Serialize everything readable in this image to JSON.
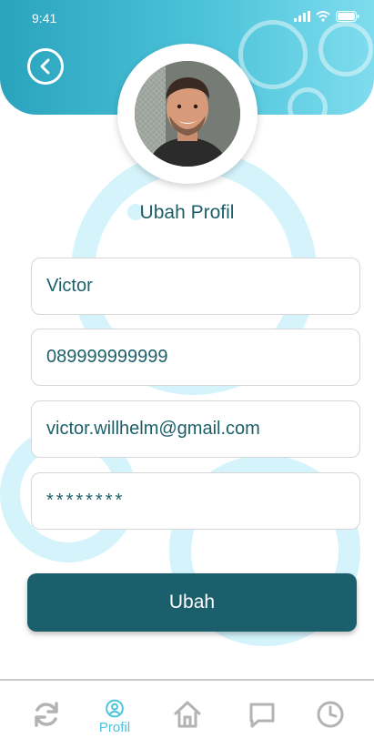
{
  "status_bar": {
    "time": "9:41"
  },
  "profile": {
    "edit_title": "Ubah Profil"
  },
  "form": {
    "name": "Victor",
    "phone": "089999999999",
    "email": "victor.willhelm@gmail.com",
    "password": "********"
  },
  "actions": {
    "submit_label": "Ubah"
  },
  "nav": {
    "items": [
      {
        "icon": "refresh-icon"
      },
      {
        "icon": "profile-icon",
        "label": "Profil",
        "active": true
      },
      {
        "icon": "home-icon"
      },
      {
        "icon": "chat-icon"
      },
      {
        "icon": "clock-icon"
      }
    ]
  },
  "colors": {
    "primary": "#1c5f6c",
    "accent": "#49c4de",
    "header_start": "#2aa3bd",
    "header_end": "#7fdcee",
    "ring": "#d4f3fb"
  }
}
